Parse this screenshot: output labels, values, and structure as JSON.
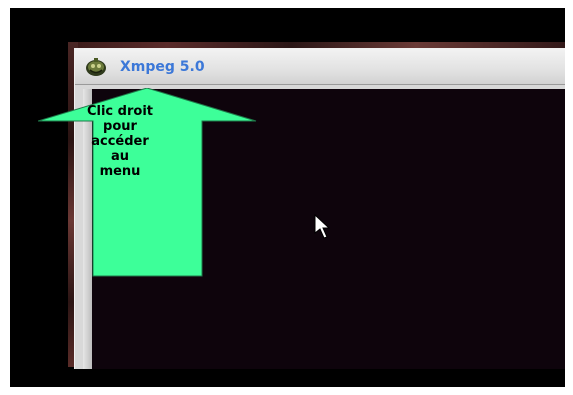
{
  "window": {
    "title": "Xmpeg 5.0",
    "icon": "xmpeg-app-icon"
  },
  "callout": {
    "lines": [
      "Clic droit",
      "pour",
      "accéder",
      "au",
      "menu"
    ],
    "color": "#3dff99"
  },
  "cursor": {
    "icon": "arrow-cursor-icon"
  },
  "colors": {
    "title_text": "#3c78d8",
    "video_background": "#0e040c",
    "window_chrome": "#d8d8d8"
  }
}
